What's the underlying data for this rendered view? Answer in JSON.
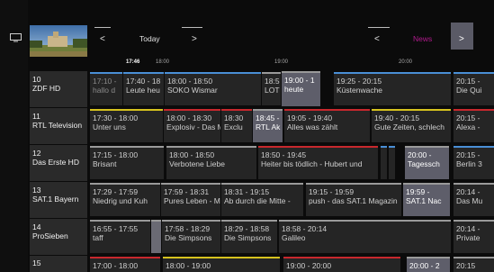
{
  "header": {
    "prev_label": "<",
    "today_label": "Today",
    "next_label": ">",
    "prev2_label": "<",
    "news_label": "News",
    "next2_label": ">"
  },
  "timebar": {
    "now": "17:46",
    "t1": "18:00",
    "t2": "19:00",
    "t3": "20:00"
  },
  "colors": {
    "blue": "#4a8fd6",
    "red": "#c8282d",
    "yellow": "#d6c21e",
    "purple": "#b01a8c",
    "selected": "#5e5e6a"
  },
  "rows": [
    {
      "number": "10",
      "name": "ZDF HD",
      "programs": [
        {
          "time": "17:10 -",
          "title": "hallo d"
        },
        {
          "time": "17:40 - 18",
          "title": "Leute heu"
        },
        {
          "time": "18:00 - 18:50",
          "title": "SOKO Wismar"
        },
        {
          "time": "18:5",
          "title": "LOT"
        },
        {
          "time": "19:00 - 1",
          "title": "heute"
        },
        {
          "time": "19:25 - 20:15",
          "title": "Küstenwache"
        },
        {
          "time": "20:15 -",
          "title": "Die Qui"
        }
      ]
    },
    {
      "number": "11",
      "name": "RTL Television",
      "programs": [
        {
          "time": "17:30 - 18:00",
          "title": "Unter uns"
        },
        {
          "time": "18:00 - 18:30",
          "title": "Explosiv - Das M"
        },
        {
          "time": "18:30",
          "title": "Exclu"
        },
        {
          "time": "18:45 -",
          "title": "RTL Ak"
        },
        {
          "time": "19:05 - 19:40",
          "title": "Alles was zählt"
        },
        {
          "time": "19:40 - 20:15",
          "title": "Gute Zeiten, schlech"
        },
        {
          "time": "20:15 -",
          "title": "Alexa -"
        }
      ]
    },
    {
      "number": "12",
      "name": "Das Erste HD",
      "programs": [
        {
          "time": "17:15 - 18:00",
          "title": "Brisant"
        },
        {
          "time": "18:00 - 18:50",
          "title": "Verbotene Liebe"
        },
        {
          "time": "18:50 - 19:45",
          "title": "Heiter bis tödlich - Hubert und"
        },
        {
          "time": "",
          "title": ""
        },
        {
          "time": "",
          "title": ""
        },
        {
          "time": "20:00 -",
          "title": "Tagessch"
        },
        {
          "time": "20:15 -",
          "title": "Berlin 3"
        }
      ]
    },
    {
      "number": "13",
      "name": "SAT.1 Bayern",
      "programs": [
        {
          "time": "17:29 - 17:59",
          "title": "Niedrig und Kuh"
        },
        {
          "time": "17:59 - 18:31",
          "title": "Pures Leben - M"
        },
        {
          "time": "18:31 - 19:15",
          "title": "Ab durch die Mitte -"
        },
        {
          "time": "19:15 - 19:59",
          "title": "push - das SAT.1 Magazin"
        },
        {
          "time": "19:59 -",
          "title": "SAT.1 Nac"
        },
        {
          "time": "20:14 -",
          "title": "Das Mu"
        }
      ]
    },
    {
      "number": "14",
      "name": "ProSieben",
      "programs": [
        {
          "time": "16:55 - 17:55",
          "title": "taff"
        },
        {
          "time": "",
          "title": ""
        },
        {
          "time": "17:58 - 18:29",
          "title": "Die Simpsons"
        },
        {
          "time": "18:29 - 18:58",
          "title": "Die Simpsons"
        },
        {
          "time": "18:58 - 20:14",
          "title": "Galileo"
        },
        {
          "time": "20:14 -",
          "title": "Private"
        }
      ]
    },
    {
      "number": "15",
      "name": "",
      "programs": [
        {
          "time": "17:00 - 18:00",
          "title": ""
        },
        {
          "time": "18:00 - 19:00",
          "title": ""
        },
        {
          "time": "19:00 - 20:00",
          "title": ""
        },
        {
          "time": "20:00 - 2",
          "title": ""
        },
        {
          "time": "20:15",
          "title": ""
        }
      ]
    }
  ]
}
